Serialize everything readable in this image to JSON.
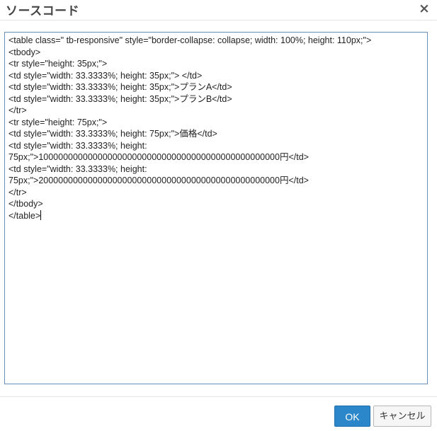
{
  "dialog": {
    "title": "ソースコード",
    "close_icon": "×"
  },
  "editor": {
    "content": "<table class=\" tb-responsive\" style=\"border-collapse: collapse; width: 100%; height: 110px;\">\n<tbody>\n<tr style=\"height: 35px;\">\n<td style=\"width: 33.3333%; height: 35px;\"> </td>\n<td style=\"width: 33.3333%; height: 35px;\">プランA</td>\n<td style=\"width: 33.3333%; height: 35px;\">プランB</td>\n</tr>\n<tr style=\"height: 75px;\">\n<td style=\"width: 33.3333%; height: 75px;\">価格</td>\n<td style=\"width: 33.3333%; height:\n75px;\">1000000000000000000000000000000000000000000000000円</td>\n<td style=\"width: 33.3333%; height:\n75px;\">2000000000000000000000000000000000000000000000000円</td>\n</tr>\n</tbody>\n</table>"
  },
  "footer": {
    "ok_label": "OK",
    "cancel_label": "キャンセル"
  }
}
